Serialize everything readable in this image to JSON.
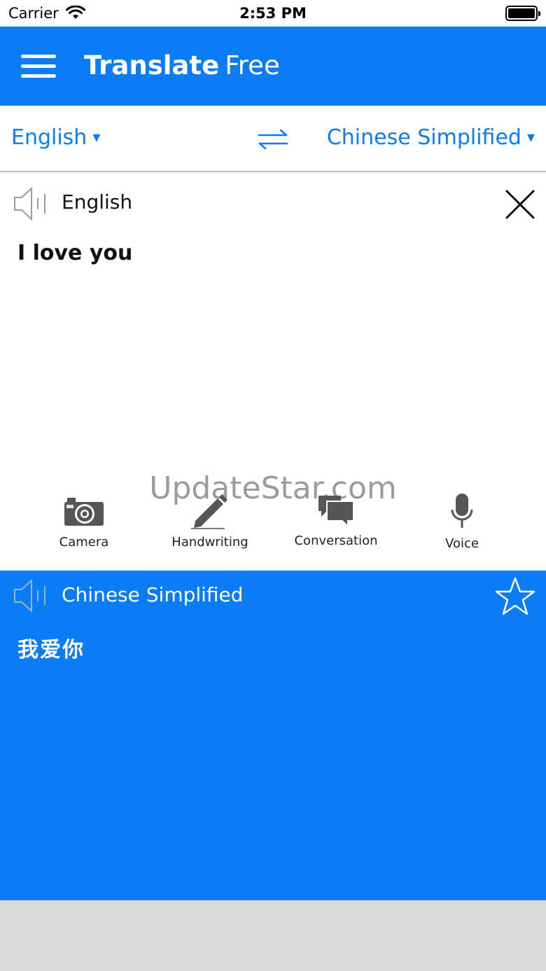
{
  "status_bar": {
    "carrier": "Carrier",
    "time": "2:53 PM"
  },
  "nav": {
    "title_bold": "Translate",
    "title_light": "Free"
  },
  "languages": {
    "source": "English",
    "target": "Chinese Simplified",
    "caret": "▾"
  },
  "source_panel": {
    "language_label": "English",
    "text": "I love you"
  },
  "watermark": "UpdateStar.com",
  "tools": [
    {
      "label": "Camera",
      "icon": "camera-icon"
    },
    {
      "label": "Handwriting",
      "icon": "pencil-icon"
    },
    {
      "label": "Conversation",
      "icon": "chat-bubbles-icon"
    },
    {
      "label": "Voice",
      "icon": "microphone-icon"
    }
  ],
  "target_panel": {
    "language_label": "Chinese Simplified",
    "text": "我爱你"
  },
  "colors": {
    "accent": "#0a7cf5",
    "icon_gray": "#555555",
    "footer_gray": "#d9d9da"
  }
}
